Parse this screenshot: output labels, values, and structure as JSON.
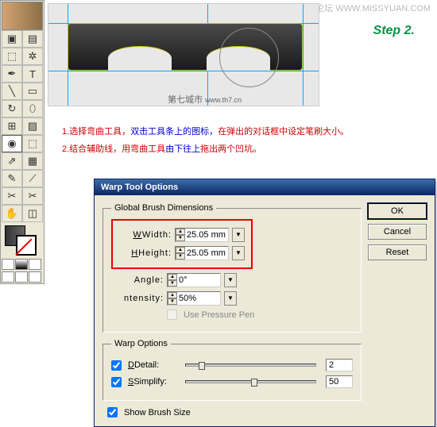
{
  "watermark": {
    "text": "思缘设计论坛",
    "url": "WWW.MISSYUAN.COM"
  },
  "canvas_wm": {
    "text": "第七城市",
    "url": "www.th7.cn"
  },
  "step_label": "Step 2.",
  "instructions": {
    "line1": {
      "num": "1.",
      "a": "选择弯曲工具，",
      "b": "双击工具条上的图标，",
      "c": "在弹出的对话框中设定笔刷大小。"
    },
    "line2": {
      "num": "2.",
      "a": "结合辅助线，用弯曲工具",
      "b": "由下往上",
      "c": "拖出两个凹坑。"
    }
  },
  "dialog": {
    "title": "Warp Tool Options",
    "ok": "OK",
    "cancel": "Cancel",
    "reset": "Reset",
    "group1": "Global Brush Dimensions",
    "width_lbl": "Width:",
    "width_val": "25.05 mm",
    "height_lbl": "Height:",
    "height_val": "25.05 mm",
    "angle_lbl": "Angle:",
    "angle_val": "0°",
    "intensity_lbl": "ntensity:",
    "intensity_val": "50%",
    "pressure": "Use Pressure Pen",
    "group2": "Warp Options",
    "detail_lbl": "Detail:",
    "detail_val": "2",
    "simplify_lbl": "Simplify:",
    "simplify_val": "50",
    "showbrush": "Show Brush Size"
  },
  "tools": [
    [
      "▣",
      "▤"
    ],
    [
      "⬚",
      "✲"
    ],
    [
      "✒",
      "T"
    ],
    [
      "╲",
      "▭"
    ],
    [
      "↻",
      "⬯"
    ],
    [
      "⊞",
      "▨"
    ],
    [
      "◉",
      "⬚"
    ],
    [
      "⇗",
      "▦"
    ],
    [
      "✎",
      "⟋"
    ],
    [
      "✂",
      "✂"
    ],
    [
      "✋",
      "◫"
    ]
  ]
}
